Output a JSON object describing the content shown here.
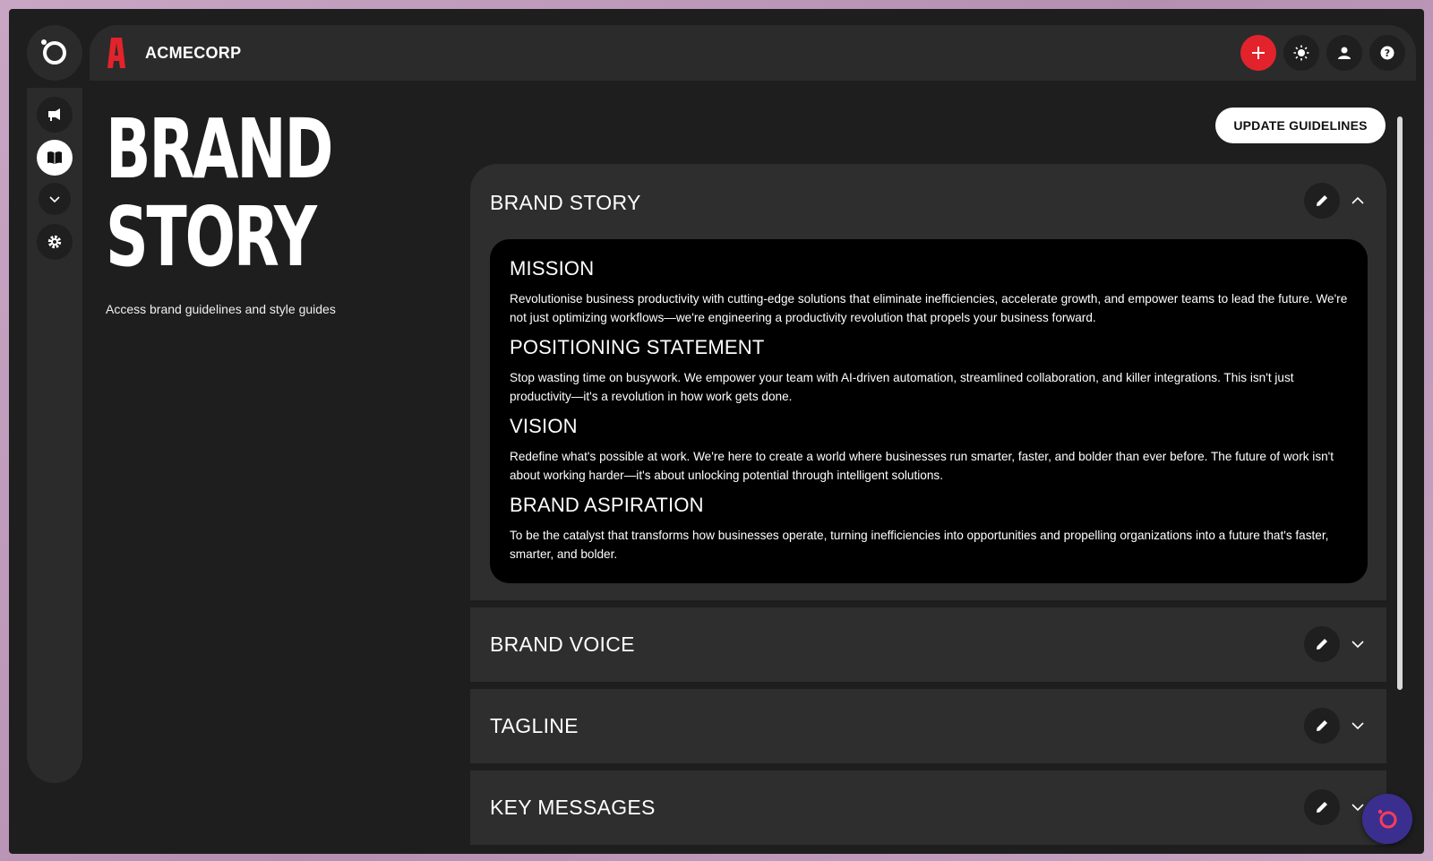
{
  "header": {
    "company_name": "ACMECORP",
    "brand_color": "#e3232b"
  },
  "page": {
    "title": "BRAND\nSTORY",
    "subtitle": "Access brand guidelines and style guides",
    "update_button_label": "UPDATE GUIDELINES"
  },
  "sidebar": {
    "items": [
      {
        "icon": "megaphone-icon"
      },
      {
        "icon": "book-icon",
        "active": true
      },
      {
        "icon": "chevron-down-icon"
      },
      {
        "icon": "gear-icon"
      }
    ]
  },
  "top_actions": [
    {
      "icon": "plus-icon"
    },
    {
      "icon": "sun-icon"
    },
    {
      "icon": "user-icon"
    },
    {
      "icon": "help-icon"
    }
  ],
  "sections": {
    "brand_story": {
      "title": "BRAND STORY",
      "expanded": true,
      "blocks": [
        {
          "heading": "MISSION",
          "text": "Revolutionise business productivity with cutting-edge solutions that eliminate inefficiencies, accelerate growth, and empower teams to lead the future. We're not just optimizing workflows—we're engineering a productivity revolution that propels your business forward."
        },
        {
          "heading": "POSITIONING STATEMENT",
          "text": "Stop wasting time on busywork. We empower your team with AI-driven automation, streamlined collaboration, and killer integrations. This isn't just productivity—it's a revolution in how work gets done."
        },
        {
          "heading": "VISION",
          "text": "Redefine what's possible at work. We're here to create a world where businesses run smarter, faster, and bolder than ever before. The future of work isn't about working harder—it's about unlocking potential through intelligent solutions."
        },
        {
          "heading": "BRAND ASPIRATION",
          "text": "To be the catalyst that transforms how businesses operate, turning inefficiencies into opportunities and propelling organizations into a future that's faster, smarter, and bolder."
        }
      ]
    },
    "brand_voice": {
      "title": "BRAND VOICE",
      "expanded": false
    },
    "tagline": {
      "title": "TAGLINE",
      "expanded": false
    },
    "key_messages": {
      "title": "KEY MESSAGES",
      "expanded": false
    }
  }
}
